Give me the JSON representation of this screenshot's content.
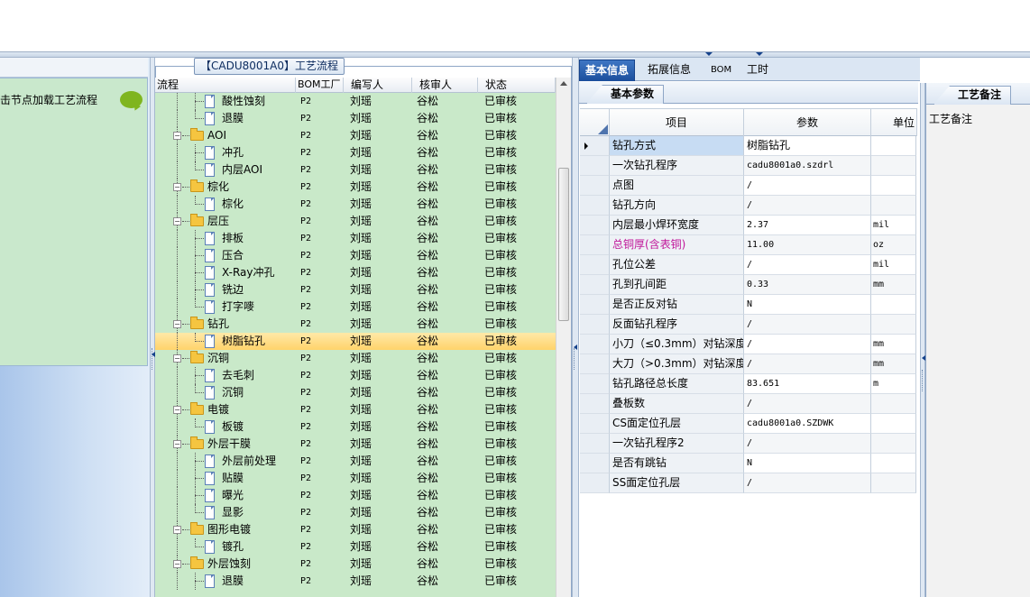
{
  "left_panel": {
    "hint": "击节点加载工艺流程"
  },
  "tree": {
    "title": "【CADU8001A0】工艺流程",
    "columns": [
      "流程",
      "BOM工厂",
      "编写人",
      "核审人",
      "状态"
    ],
    "rows": [
      {
        "name": "酸性蚀刻",
        "level": 1,
        "bom": "P2",
        "writer": "刘瑶",
        "reviewer": "谷松",
        "status": "已审核"
      },
      {
        "name": "退膜",
        "level": 1,
        "last": true,
        "bom": "P2",
        "writer": "刘瑶",
        "reviewer": "谷松",
        "status": "已审核"
      },
      {
        "name": "AOI",
        "level": 0,
        "bom": "P2",
        "writer": "刘瑶",
        "reviewer": "谷松",
        "status": "已审核"
      },
      {
        "name": "冲孔",
        "level": 1,
        "bom": "P2",
        "writer": "刘瑶",
        "reviewer": "谷松",
        "status": "已审核"
      },
      {
        "name": "内层AOI",
        "level": 1,
        "last": true,
        "bom": "P2",
        "writer": "刘瑶",
        "reviewer": "谷松",
        "status": "已审核"
      },
      {
        "name": "棕化",
        "level": 0,
        "bom": "P2",
        "writer": "刘瑶",
        "reviewer": "谷松",
        "status": "已审核"
      },
      {
        "name": "棕化",
        "level": 1,
        "last": true,
        "bom": "P2",
        "writer": "刘瑶",
        "reviewer": "谷松",
        "status": "已审核"
      },
      {
        "name": "层压",
        "level": 0,
        "bom": "P2",
        "writer": "刘瑶",
        "reviewer": "谷松",
        "status": "已审核"
      },
      {
        "name": "排板",
        "level": 1,
        "bom": "P2",
        "writer": "刘瑶",
        "reviewer": "谷松",
        "status": "已审核"
      },
      {
        "name": "压合",
        "level": 1,
        "bom": "P2",
        "writer": "刘瑶",
        "reviewer": "谷松",
        "status": "已审核"
      },
      {
        "name": "X-Ray冲孔",
        "level": 1,
        "bom": "P2",
        "writer": "刘瑶",
        "reviewer": "谷松",
        "status": "已审核"
      },
      {
        "name": "铣边",
        "level": 1,
        "bom": "P2",
        "writer": "刘瑶",
        "reviewer": "谷松",
        "status": "已审核"
      },
      {
        "name": "打字嘜",
        "level": 1,
        "last": true,
        "bom": "P2",
        "writer": "刘瑶",
        "reviewer": "谷松",
        "status": "已审核"
      },
      {
        "name": "钻孔",
        "level": 0,
        "bom": "P2",
        "writer": "刘瑶",
        "reviewer": "谷松",
        "status": "已审核"
      },
      {
        "name": "树脂钻孔",
        "level": 1,
        "last": true,
        "selected": true,
        "bom": "P2",
        "writer": "刘瑶",
        "reviewer": "谷松",
        "status": "已审核"
      },
      {
        "name": "沉铜",
        "level": 0,
        "bom": "P2",
        "writer": "刘瑶",
        "reviewer": "谷松",
        "status": "已审核"
      },
      {
        "name": "去毛刺",
        "level": 1,
        "bom": "P2",
        "writer": "刘瑶",
        "reviewer": "谷松",
        "status": "已审核"
      },
      {
        "name": "沉铜",
        "level": 1,
        "last": true,
        "bom": "P2",
        "writer": "刘瑶",
        "reviewer": "谷松",
        "status": "已审核"
      },
      {
        "name": "电镀",
        "level": 0,
        "bom": "P2",
        "writer": "刘瑶",
        "reviewer": "谷松",
        "status": "已审核"
      },
      {
        "name": "板镀",
        "level": 1,
        "last": true,
        "bom": "P2",
        "writer": "刘瑶",
        "reviewer": "谷松",
        "status": "已审核"
      },
      {
        "name": "外层干膜",
        "level": 0,
        "bom": "P2",
        "writer": "刘瑶",
        "reviewer": "谷松",
        "status": "已审核"
      },
      {
        "name": "外层前处理",
        "level": 1,
        "bom": "P2",
        "writer": "刘瑶",
        "reviewer": "谷松",
        "status": "已审核"
      },
      {
        "name": "贴膜",
        "level": 1,
        "bom": "P2",
        "writer": "刘瑶",
        "reviewer": "谷松",
        "status": "已审核"
      },
      {
        "name": "曝光",
        "level": 1,
        "bom": "P2",
        "writer": "刘瑶",
        "reviewer": "谷松",
        "status": "已审核"
      },
      {
        "name": "显影",
        "level": 1,
        "last": true,
        "bom": "P2",
        "writer": "刘瑶",
        "reviewer": "谷松",
        "status": "已审核"
      },
      {
        "name": "图形电镀",
        "level": 0,
        "bom": "P2",
        "writer": "刘瑶",
        "reviewer": "谷松",
        "status": "已审核"
      },
      {
        "name": "镀孔",
        "level": 1,
        "last": true,
        "bom": "P2",
        "writer": "刘瑶",
        "reviewer": "谷松",
        "status": "已审核"
      },
      {
        "name": "外层蚀刻",
        "level": 0,
        "bom": "P2",
        "writer": "刘瑶",
        "reviewer": "谷松",
        "status": "已审核"
      },
      {
        "name": "退膜",
        "level": 1,
        "bom": "P2",
        "writer": "刘瑶",
        "reviewer": "谷松",
        "status": "已审核"
      }
    ]
  },
  "main_tabs": [
    {
      "label": "基本信息",
      "active": true
    },
    {
      "label": "拓展信息",
      "active": false
    },
    {
      "label": "BOM",
      "active": false
    },
    {
      "label": "工时",
      "active": false
    }
  ],
  "sub_tab": "基本参数",
  "param_grid": {
    "columns": [
      "项目",
      "参数",
      "单位"
    ],
    "rows": [
      {
        "item": "钻孔方式",
        "value": "树脂钻孔",
        "unit": "",
        "current": true
      },
      {
        "item": "一次钻孔程序",
        "value": "cadu8001a0.szdrl",
        "unit": ""
      },
      {
        "item": "点图",
        "value": "/",
        "unit": ""
      },
      {
        "item": "钻孔方向",
        "value": "/",
        "unit": ""
      },
      {
        "item": "内层最小焊环宽度",
        "value": "2.37",
        "unit": "mil"
      },
      {
        "item": "总铜厚(含表铜)",
        "value": "11.00",
        "unit": "oz",
        "highlight": true
      },
      {
        "item": "孔位公差",
        "value": "/",
        "unit": "mil"
      },
      {
        "item": "孔到孔间距",
        "value": "0.33",
        "unit": "mm"
      },
      {
        "item": "是否正反对钻",
        "value": "N",
        "unit": ""
      },
      {
        "item": "反面钻孔程序",
        "value": "/",
        "unit": ""
      },
      {
        "item": "小刀（≤0.3mm）对钻深度",
        "value": "/",
        "unit": "mm"
      },
      {
        "item": "大刀（>0.3mm）对钻深度",
        "value": "/",
        "unit": "mm"
      },
      {
        "item": "钻孔路径总长度",
        "value": "83.651",
        "unit": "m"
      },
      {
        "item": "叠板数",
        "value": "/",
        "unit": ""
      },
      {
        "item": "CS面定位孔层",
        "value": "cadu8001a0.SZDWK",
        "unit": ""
      },
      {
        "item": "一次钻孔程序2",
        "value": "/",
        "unit": ""
      },
      {
        "item": "是否有跳钻",
        "value": "N",
        "unit": ""
      },
      {
        "item": "SS面定位孔层",
        "value": "/",
        "unit": ""
      }
    ]
  },
  "note_panel": {
    "tab": "工艺备注",
    "label": "工艺备注"
  },
  "colors": {
    "grid_green": "#c9e9c9",
    "selected_row": "#ffd36b",
    "active_tab": "#1b4e9c",
    "highlight_text": "#c0169a"
  }
}
